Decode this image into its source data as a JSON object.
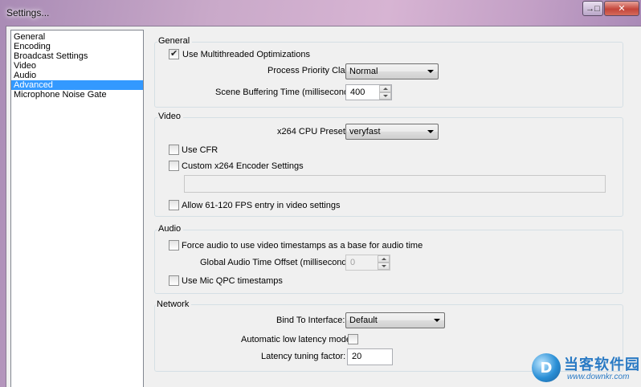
{
  "window": {
    "title": "Settings...",
    "help_glyph": "→□",
    "close_glyph": "✕"
  },
  "sidebar": {
    "items": [
      {
        "label": "General",
        "selected": false
      },
      {
        "label": "Encoding",
        "selected": false
      },
      {
        "label": "Broadcast Settings",
        "selected": false
      },
      {
        "label": "Video",
        "selected": false
      },
      {
        "label": "Audio",
        "selected": false
      },
      {
        "label": "Advanced",
        "selected": true
      },
      {
        "label": "Microphone Noise Gate",
        "selected": false
      }
    ]
  },
  "general": {
    "group_label": "General",
    "multithreaded": {
      "label": "Use Multithreaded Optimizations",
      "checked": true
    },
    "priority": {
      "label": "Process Priority Class",
      "value": "Normal"
    },
    "buffering": {
      "label": "Scene Buffering Time (milliseconds):",
      "value": "400"
    }
  },
  "video": {
    "group_label": "Video",
    "preset": {
      "label": "x264 CPU Preset:",
      "value": "veryfast"
    },
    "use_cfr": {
      "label": "Use CFR",
      "checked": false
    },
    "custom_settings": {
      "label": "Custom x264 Encoder Settings",
      "checked": false,
      "value": ""
    },
    "allow_fps": {
      "label": "Allow 61-120 FPS entry in video settings",
      "checked": false
    }
  },
  "audio": {
    "group_label": "Audio",
    "force_timestamps": {
      "label": "Force audio to use video timestamps as a base for audio time",
      "checked": false
    },
    "offset": {
      "label": "Global Audio Time Offset (milliseconds):",
      "value": "0"
    },
    "mic_qpc": {
      "label": "Use Mic QPC timestamps",
      "checked": false
    }
  },
  "network": {
    "group_label": "Network",
    "bind": {
      "label": "Bind To Interface:",
      "value": "Default"
    },
    "low_latency": {
      "label": "Automatic low latency mode:",
      "checked": false
    },
    "latency_factor": {
      "label": "Latency tuning factor:",
      "value": "20"
    }
  },
  "watermark": {
    "logo_glyph": "D",
    "name": "当客软件园",
    "url": "www.downkr.com"
  }
}
